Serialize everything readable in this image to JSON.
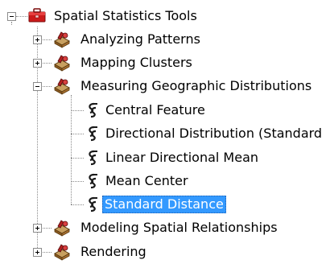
{
  "tree": {
    "root": {
      "label": "Spatial Statistics Tools",
      "icon": "red-toolbox-icon",
      "expanded": true
    },
    "toolsets": [
      {
        "label": "Analyzing Patterns",
        "icon": "toolset-icon",
        "expanded": false
      },
      {
        "label": "Mapping Clusters",
        "icon": "toolset-icon",
        "expanded": false
      },
      {
        "label": "Measuring Geographic Distributions",
        "icon": "toolset-icon",
        "expanded": true,
        "tools": [
          {
            "label": "Central Feature",
            "icon": "script-tool-icon",
            "selected": false
          },
          {
            "label": "Directional Distribution (Standard",
            "icon": "script-tool-icon",
            "selected": false
          },
          {
            "label": "Linear Directional Mean",
            "icon": "script-tool-icon",
            "selected": false
          },
          {
            "label": "Mean Center",
            "icon": "script-tool-icon",
            "selected": false
          },
          {
            "label": "Standard Distance",
            "icon": "script-tool-icon",
            "selected": true
          }
        ]
      },
      {
        "label": "Modeling Spatial Relationships",
        "icon": "toolset-icon",
        "expanded": false
      },
      {
        "label": "Rendering",
        "icon": "toolset-icon",
        "expanded": false
      }
    ]
  },
  "colors": {
    "selection_background": "#3399ff",
    "selection_text": "#ffffff",
    "toolbox_red": "#cc1b1b",
    "connector_line": "#8a8a8a"
  }
}
